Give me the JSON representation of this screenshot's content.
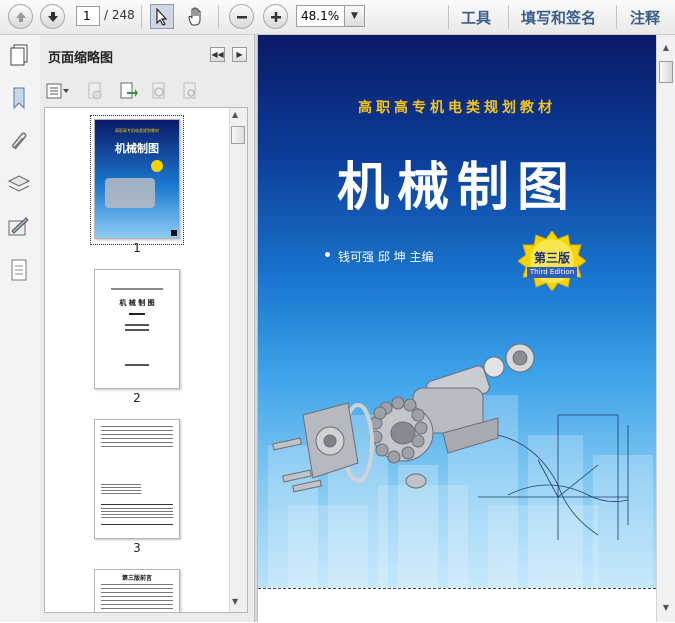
{
  "toolbar": {
    "page_current": "1",
    "page_total": "/ 248",
    "zoom": "48.1%",
    "menu": [
      "工具",
      "填写和签名",
      "注释"
    ]
  },
  "sidebar": {
    "title": "页面缩略图",
    "icons": [
      "bookmark-icon",
      "attachment-icon",
      "layers-icon",
      "signature-icon",
      "page-icon"
    ]
  },
  "thumbnails": [
    {
      "label": "1",
      "cover_series": "高职高专机电类规划教材",
      "cover_title": "机械制图"
    },
    {
      "label": "2",
      "title": "机 械 制 图"
    },
    {
      "label": "3"
    },
    {
      "label": "",
      "title": "第三版前言"
    }
  ],
  "document": {
    "series": "高职高专机电类规划教材",
    "title": "机械制图",
    "authors": "钱可强  邱 坤  主编",
    "badge_main": "第三版",
    "badge_sub": "Third Edition"
  },
  "colors": {
    "menu_text": "#3a5f8a",
    "badge": "#f5d400",
    "cover_title": "#ffffff",
    "cover_series": "#f5c51a"
  }
}
